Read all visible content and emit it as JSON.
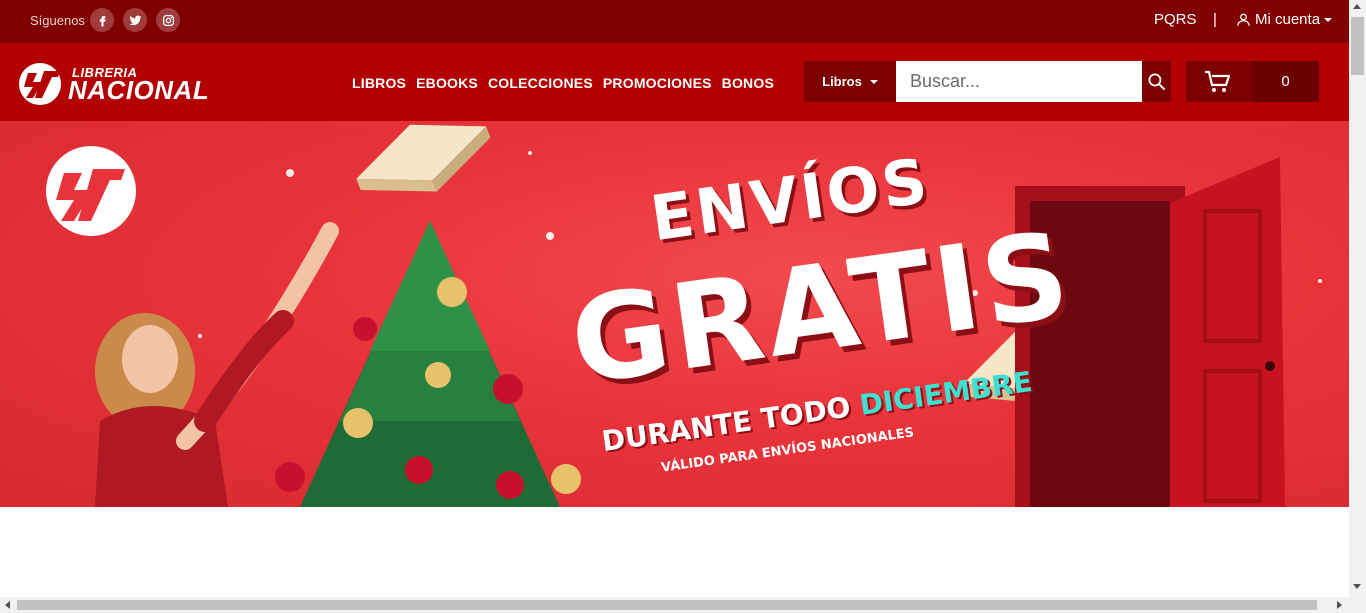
{
  "topbar": {
    "follow_label": "Síguenos",
    "social": [
      {
        "icon": "facebook-icon"
      },
      {
        "icon": "twitter-icon"
      },
      {
        "icon": "instagram-icon"
      }
    ],
    "pqrs": "PQRS",
    "separator": "|",
    "account": "Mi cuenta"
  },
  "header": {
    "logo_top": "LIBRERIA",
    "logo_bottom": "NACIONAL",
    "nav": [
      "LIBROS",
      "EBOOKS",
      "COLECCIONES",
      "PROMOCIONES",
      "BONOS"
    ],
    "category_select": "Libros",
    "search_placeholder": "Buscar...",
    "cart_count": "0"
  },
  "banner": {
    "line1": "ENVÍOS",
    "line2": "GRATIS",
    "line3_prefix": "DURANTE TODO",
    "line3_accent": "DICIEMBRE",
    "line4": "VÁLIDO PARA ENVÍOS NACIONALES"
  },
  "colors": {
    "topbar": "#800000",
    "header": "#b30000",
    "dark_control": "#7d0000",
    "banner": "#e9333a",
    "accent": "#3ee0d2"
  }
}
